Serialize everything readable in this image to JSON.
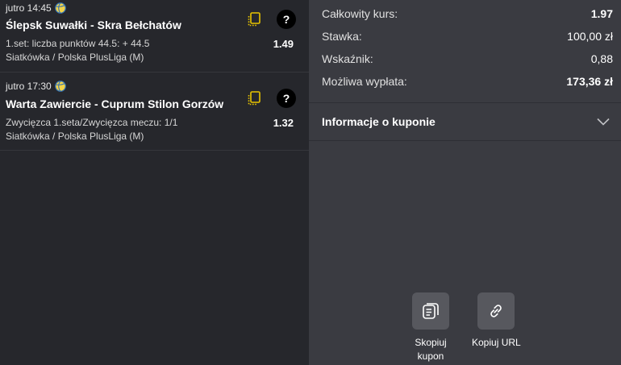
{
  "bets": [
    {
      "time": "jutro 14:45",
      "title": "Ślepsk Suwałki - Skra Bełchatów",
      "market": "1.set: liczba punktów 44.5: + 44.5",
      "odds": "1.49",
      "league": "Siatkówka / Polska PlusLiga (M)"
    },
    {
      "time": "jutro 17:30",
      "title": "Warta Zawiercie - Cuprum Stilon Gorzów",
      "market": "Zwycięzca 1.seta/Zwycięzca meczu: 1/1",
      "odds": "1.32",
      "league": "Siatkówka / Polska PlusLiga (M)"
    }
  ],
  "summary": {
    "total_odds_label": "Całkowity kurs:",
    "total_odds_value": "1.97",
    "stake_label": "Stawka:",
    "stake_value": "100,00 zł",
    "ratio_label": "Wskaźnik:",
    "ratio_value": "0,88",
    "payout_label": "Możliwa wypłata:",
    "payout_value": "173,36 zł"
  },
  "info": {
    "label": "Informacje o kuponie"
  },
  "actions": {
    "copy_coupon": "Skopiuj\nkupon",
    "copy_coupon_line1": "Skopiuj",
    "copy_coupon_line2": "kupon",
    "copy_url": "Kopiuj URL"
  },
  "colors": {
    "accent_yellow": "#e8c400",
    "panel_left": "#26272c",
    "panel_right": "#3a3b41",
    "button_bg": "#57585e"
  },
  "icons": {
    "sport": "volleyball-icon",
    "copy": "copy-icon",
    "help": "question-icon",
    "chevron": "chevron-down-icon",
    "coupon": "coupon-icon",
    "link": "link-icon"
  }
}
